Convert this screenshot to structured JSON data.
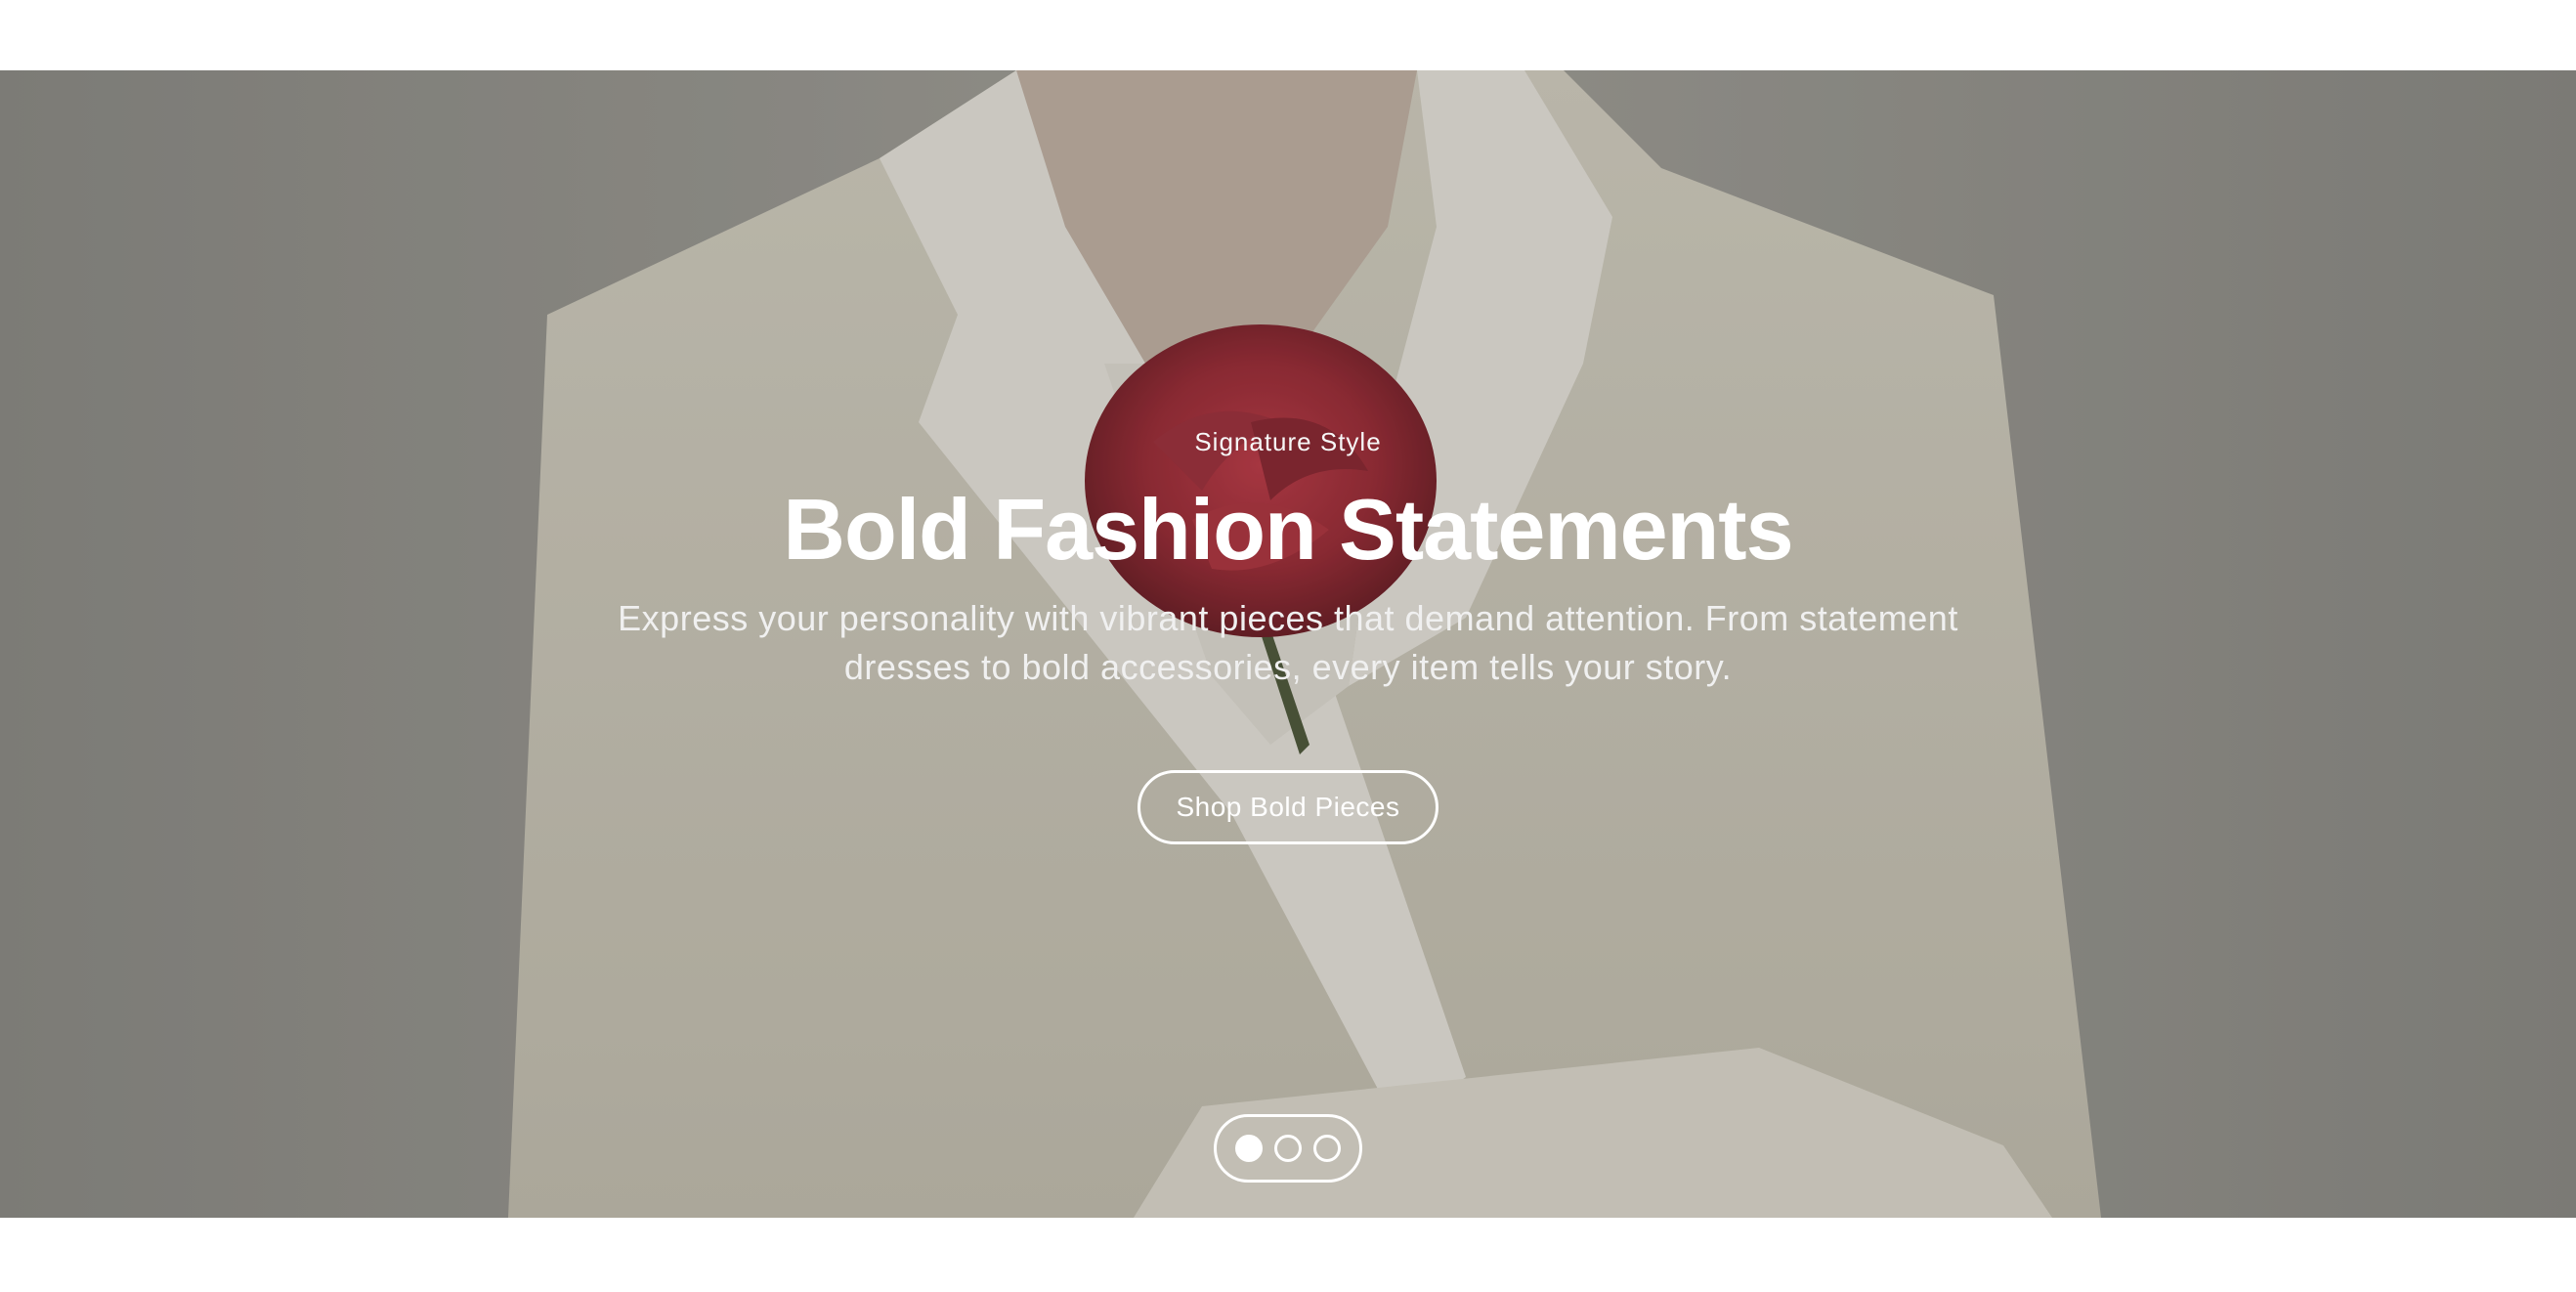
{
  "hero": {
    "eyebrow": "Signature Style",
    "headline": "Bold Fashion Statements",
    "description": "Express your personality with vibrant pieces that demand attention. From statement dresses to bold accessories, every item tells your story.",
    "cta_label": "Shop Bold Pieces",
    "image_subject": "model in cream blazer holding a red rose",
    "slides": {
      "count": 3,
      "active": 1
    },
    "colors": {
      "text": "#ffffff",
      "overlay": "#5f5f5a",
      "rose": "#b6303c",
      "blazer": "#e8e3d4"
    }
  }
}
